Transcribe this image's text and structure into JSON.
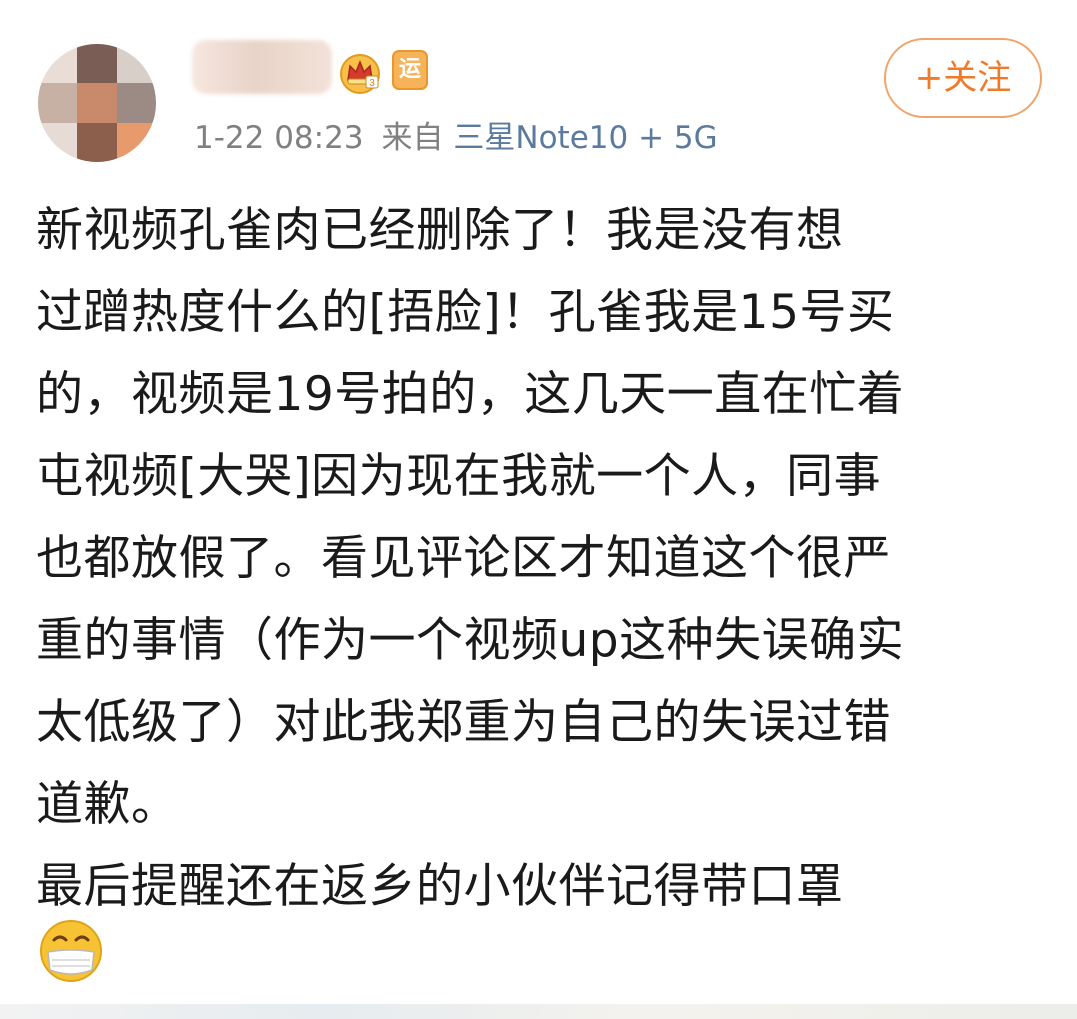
{
  "header": {
    "timestamp": "1-22 08:23",
    "from_label": "来自",
    "source": "三星Note10 +  5G",
    "follow_label": "+关注",
    "badge_text": "运"
  },
  "post": {
    "lines": [
      "新视频孔雀肉已经删除了！我是没有想",
      "过蹭热度什么的[捂脸]！孔雀我是15号买",
      "的，视频是19号拍的，这几天一直在忙着",
      "屯视频[大哭]因为现在我就一个人，同事",
      "也都放假了。看见评论区才知道这个很严",
      "重的事情（作为一个视频up这种失误确实",
      "太低级了）对此我郑重为自己的失误过错",
      "道歉。",
      "最后提醒还在返乡的小伙伴记得带口罩"
    ]
  },
  "icons": {
    "crown": "crown-icon",
    "mask_emoji": "mask-emoji-icon"
  },
  "colors": {
    "follow_accent": "#ef7b2a",
    "source_link": "#5b7a9d",
    "meta_gray": "#808080"
  }
}
